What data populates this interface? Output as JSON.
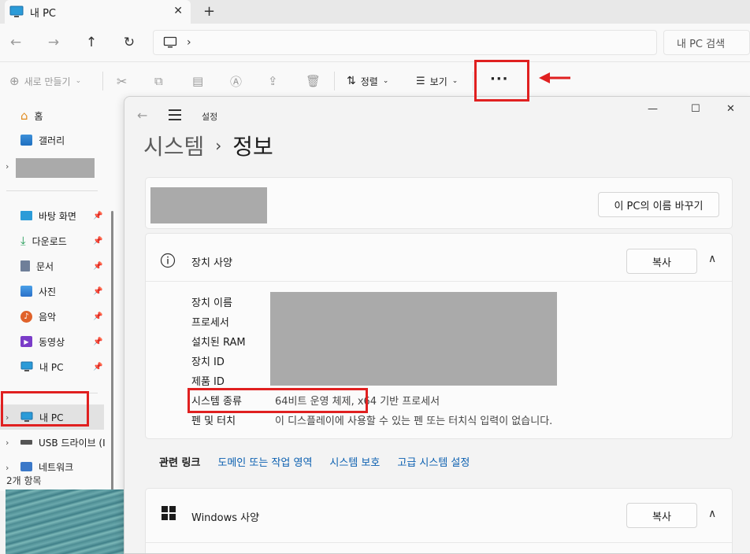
{
  "explorer": {
    "tab_title": "내 PC",
    "new_tab": "+",
    "search_placeholder": "내 PC 검색",
    "commands": {
      "new": "새로 만들기",
      "sort": "정렬",
      "view": "보기",
      "more": "···"
    },
    "sidebar": {
      "home": "홈",
      "gallery": "갤러리",
      "desktop": "바탕 화면",
      "downloads": "다운로드",
      "documents": "문서",
      "pictures": "사진",
      "music": "음악",
      "videos": "동영상",
      "mypc_pinned": "내 PC",
      "mypc": "내 PC",
      "usb": "USB 드라이브 (I",
      "network": "네트워크"
    },
    "status": "2개 항목"
  },
  "settings": {
    "app_title": "설정",
    "breadcrumb": [
      "시스템",
      "정보"
    ],
    "rename_button": "이 PC의 이름 바꾸기",
    "device_specs": {
      "title": "장치 사양",
      "copy": "복사",
      "rows": [
        {
          "label": "장치 이름",
          "value": ""
        },
        {
          "label": "프로세서",
          "value": ""
        },
        {
          "label": "설치된 RAM",
          "value": ""
        },
        {
          "label": "장치 ID",
          "value": ""
        },
        {
          "label": "제품 ID",
          "value": ""
        },
        {
          "label": "시스템 종류",
          "value": "64비트 운영 체제, x64 기반 프로세서"
        },
        {
          "label": "펜 및 터치",
          "value": "이 디스플레이에 사용할 수 있는 펜 또는 터치식 입력이 없습니다."
        }
      ]
    },
    "related_links": {
      "label": "관련 링크",
      "links": [
        "도메인 또는 작업 영역",
        "시스템 보호",
        "고급 시스템 설정"
      ]
    },
    "windows_specs": {
      "title": "Windows 사양",
      "copy": "복사"
    }
  },
  "colors": {
    "highlight_red": "#e02020",
    "link_blue": "#0a5fb0"
  }
}
